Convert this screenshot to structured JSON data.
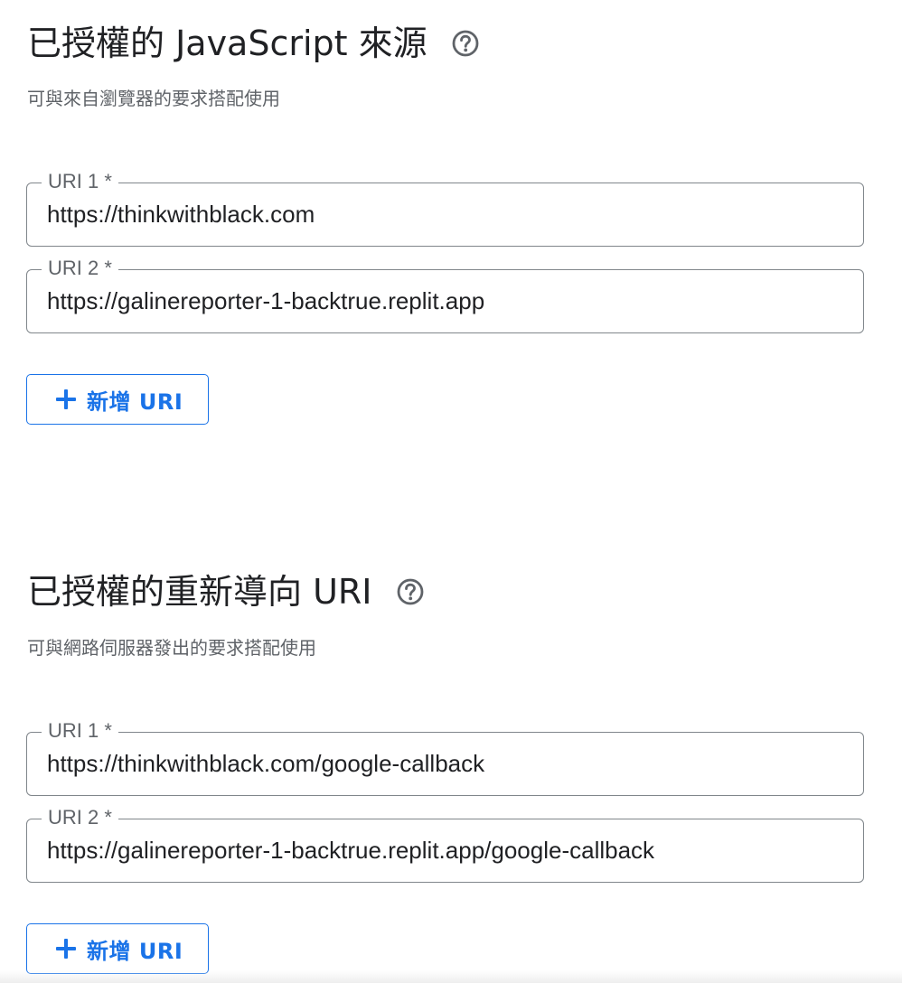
{
  "js_origins": {
    "title": "已授權的 JavaScript 來源",
    "description": "可與來自瀏覽器的要求搭配使用",
    "uris": [
      {
        "label": "URI 1 *",
        "value": "https://thinkwithblack.com"
      },
      {
        "label": "URI 2 *",
        "value": "https://galinereporter-1-backtrue.replit.app"
      }
    ],
    "add_button_label": "新增 URI"
  },
  "redirect_uris": {
    "title": "已授權的重新導向 URI",
    "description": "可與網路伺服器發出的要求搭配使用",
    "uris": [
      {
        "label": "URI 1 *",
        "value": "https://thinkwithblack.com/google-callback"
      },
      {
        "label": "URI 2 *",
        "value": "https://galinereporter-1-backtrue.replit.app/google-callback"
      }
    ],
    "add_button_label": "新增 URI"
  },
  "colors": {
    "accent": "#1a73e8",
    "text": "#202124",
    "secondary_text": "#5f6368",
    "border": "#80868b"
  },
  "icons": {
    "help": "help-circle-icon",
    "add": "plus-icon"
  }
}
